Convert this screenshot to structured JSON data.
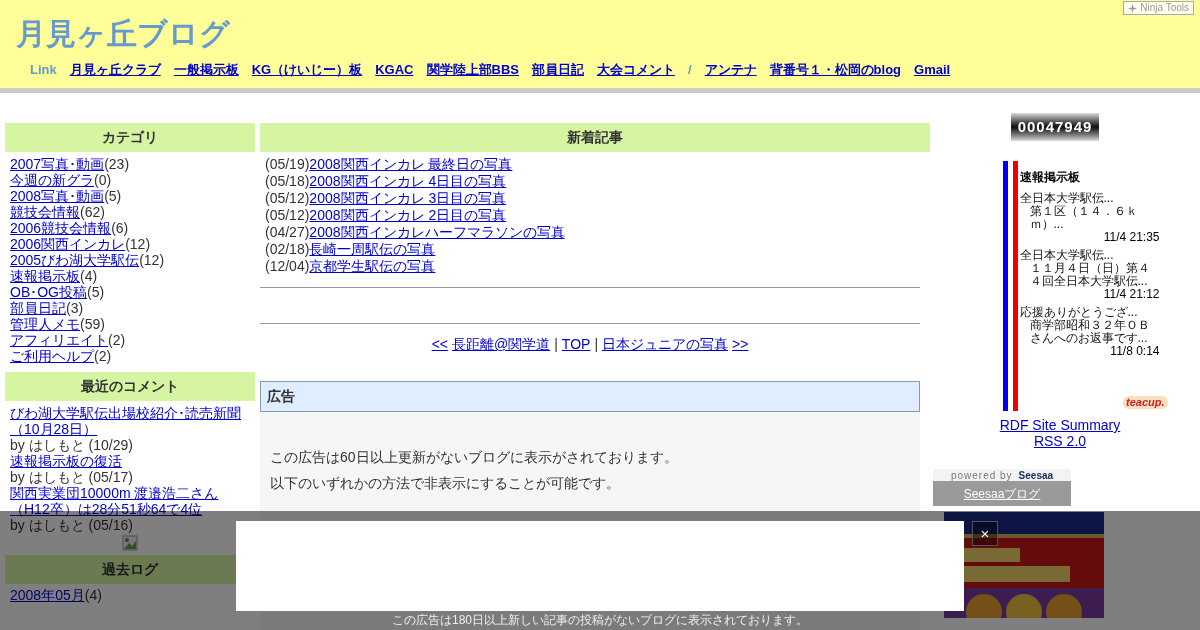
{
  "header": {
    "title": "月見ヶ丘ブログ",
    "ninja_tools": "Ninja Tools",
    "link_label": "Link",
    "links": [
      {
        "kind": "link",
        "text": "月見ヶ丘クラブ"
      },
      {
        "kind": "link",
        "text": "一般掲示板"
      },
      {
        "kind": "link",
        "text": "KG（けいじー）板"
      },
      {
        "kind": "link",
        "text": "KGAC"
      },
      {
        "kind": "link",
        "text": "関学陸上部BBS"
      },
      {
        "kind": "link",
        "text": "部員日記"
      },
      {
        "kind": "link",
        "text": "大会コメント"
      },
      {
        "kind": "separator",
        "text": "/"
      },
      {
        "kind": "link",
        "text": "アンテナ"
      },
      {
        "kind": "link",
        "text": "背番号１・松岡のblog"
      },
      {
        "kind": "link",
        "text": "Gmail"
      }
    ]
  },
  "categories": {
    "heading": "カテゴリ",
    "items": [
      {
        "name": "2007写真･動画",
        "count": "(23)"
      },
      {
        "name": "今週の新グラ",
        "count": "(0)"
      },
      {
        "name": "2008写真･動画",
        "count": "(5)"
      },
      {
        "name": "競技会情報",
        "count": "(62)"
      },
      {
        "name": "2006競技会情報",
        "count": "(6)"
      },
      {
        "name": "2006関西インカレ",
        "count": "(12)"
      },
      {
        "name": "2005びわ湖大学駅伝",
        "count": "(12)"
      },
      {
        "name": "速報掲示板",
        "count": "(4)"
      },
      {
        "name": "OB･OG投稿",
        "count": "(5)"
      },
      {
        "name": "部員日記",
        "count": "(3)"
      },
      {
        "name": "管理人メモ",
        "count": "(59)"
      },
      {
        "name": "アフィリエイト",
        "count": "(2)"
      },
      {
        "name": "ご利用ヘルプ",
        "count": "(2)"
      }
    ]
  },
  "recent_comments": {
    "heading": "最近のコメント",
    "items": [
      {
        "title": "びわ湖大学駅伝出場校紹介･読売新聞（10月28日）",
        "by": "by はしもと (10/29)"
      },
      {
        "title": "速報掲示板の復活",
        "by": "by はしもと (05/17)"
      },
      {
        "title": "関西実業団10000m 渡邉浩二さん（H12卒）は28分51秒64で4位",
        "by": "by はしもと (05/16)"
      }
    ]
  },
  "archive": {
    "heading": "過去ログ",
    "items": [
      {
        "month": "2008年05月",
        "count": "(4)"
      }
    ]
  },
  "new_articles": {
    "heading": "新着記事",
    "items": [
      {
        "date": "(05/19)",
        "title": "2008関西インカレ 最終日の写真"
      },
      {
        "date": "(05/18)",
        "title": "2008関西インカレ 4日目の写真"
      },
      {
        "date": "(05/12)",
        "title": "2008関西インカレ 3日目の写真"
      },
      {
        "date": "(05/12)",
        "title": "2008関西インカレ 2日目の写真"
      },
      {
        "date": "(04/27)",
        "title": "2008関西インカレハーフマラソンの写真"
      },
      {
        "date": "(02/18)",
        "title": "長崎一周駅伝の写真"
      },
      {
        "date": "(12/04)",
        "title": "京都学生駅伝の写真"
      }
    ]
  },
  "pager": [
    {
      "kind": "link",
      "text": "<<"
    },
    {
      "kind": "link",
      "text": "長距離@関学道"
    },
    {
      "kind": "text",
      "text": "|"
    },
    {
      "kind": "link",
      "text": "TOP"
    },
    {
      "kind": "text",
      "text": "|"
    },
    {
      "kind": "link",
      "text": "日本ジュニアの写真"
    },
    {
      "kind": "link",
      "text": ">>"
    }
  ],
  "ad": {
    "heading": "広告",
    "lines": [
      "この広告は60日以上更新がないブログに表示がされております。",
      "以下のいずれかの方法で非表示にすることが可能です。"
    ]
  },
  "counter": "00047949",
  "bbs": {
    "title": "速報掲示板",
    "brand": "teacup.",
    "posts": [
      {
        "title": "全日本大学駅伝...",
        "body": "第１区（１４．６ｋｍ）...",
        "time": "11/4 21:35"
      },
      {
        "title": "全日本大学駅伝...",
        "body": "１１月４日（日）第４４回全日本大学駅伝...",
        "time": "11/4 21:12"
      },
      {
        "title": "応援ありがとうござ...",
        "body": "商学部昭和３２年ＯＢさんへのお返事です...",
        "time": "11/8 0:14"
      }
    ]
  },
  "rss": [
    "RDF Site Summary",
    "RSS 2.0"
  ],
  "seesaa": {
    "powered": "powered by",
    "logo": "Seesaa",
    "link": "Seesaaブログ"
  },
  "banner": {
    "kind": "picture"
  },
  "overlay": {
    "close": "×",
    "notice": "この広告は180日以上新しい記事の投稿がないブログに表示されております。"
  }
}
